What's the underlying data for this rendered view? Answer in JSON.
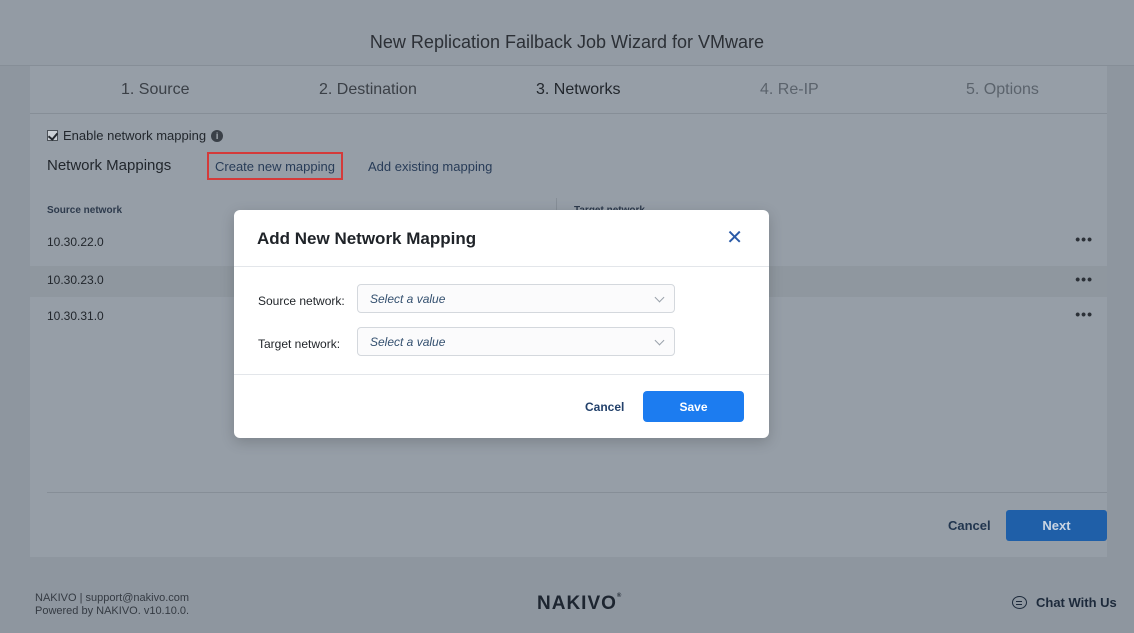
{
  "window": {
    "title": "New Replication Failback Job Wizard for VMware"
  },
  "steps": [
    {
      "label": "1. Source"
    },
    {
      "label": "2. Destination"
    },
    {
      "label": "3. Networks"
    },
    {
      "label": "4. Re-IP"
    },
    {
      "label": "5. Options"
    }
  ],
  "mapping": {
    "enable_label": "Enable network mapping",
    "enabled": true,
    "section_title": "Network Mappings",
    "create_link": "Create new mapping",
    "add_existing_link": "Add existing mapping",
    "columns": {
      "source": "Source network",
      "target": "Target network"
    },
    "rows": [
      {
        "source": "10.30.22.0",
        "more": "•••"
      },
      {
        "source": "10.30.23.0",
        "more": "•••"
      },
      {
        "source": "10.30.31.0",
        "more": "•••"
      }
    ]
  },
  "wizard_footer": {
    "cancel": "Cancel",
    "next": "Next"
  },
  "footer": {
    "line1": "NAKIVO | support@nakivo.com",
    "line2": "Powered by NAKIVO. v10.10.0.",
    "logo": "NAKIVO",
    "chat": "Chat With Us"
  },
  "modal": {
    "title": "Add New Network Mapping",
    "source_label": "Source network:",
    "source_placeholder": "Select a value",
    "target_label": "Target network:",
    "target_placeholder": "Select a value",
    "cancel": "Cancel",
    "save": "Save"
  },
  "colors": {
    "accent": "#1c7cf0",
    "highlight_border": "#d43a3a",
    "overlay": "#8e969f"
  }
}
